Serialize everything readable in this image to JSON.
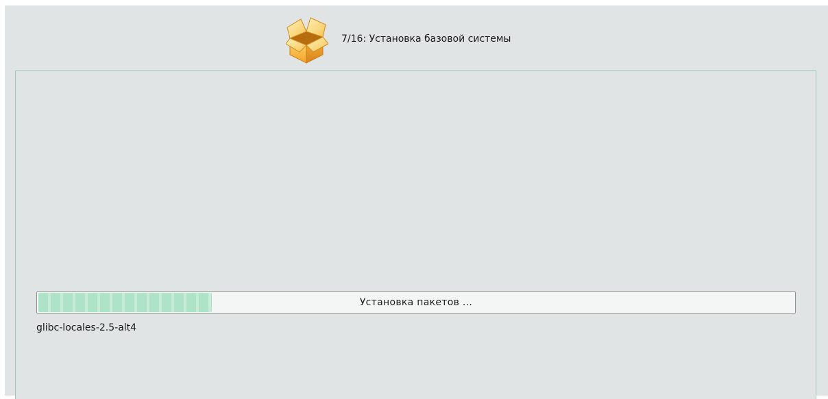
{
  "header": {
    "step_title": "7/16: Установка базовой системы",
    "icon": "package-box-icon"
  },
  "progress": {
    "label": "Установка пакетов ...",
    "fraction": 0.23
  },
  "current_package": "glibc-locales-2.5-alt4",
  "colors": {
    "background": "#e1e4e4",
    "panel_border": "#9cc9b3",
    "progress_fill": "#afe3c8",
    "progress_track": "#f4f6f5",
    "icon_orange": "#f0a020"
  }
}
